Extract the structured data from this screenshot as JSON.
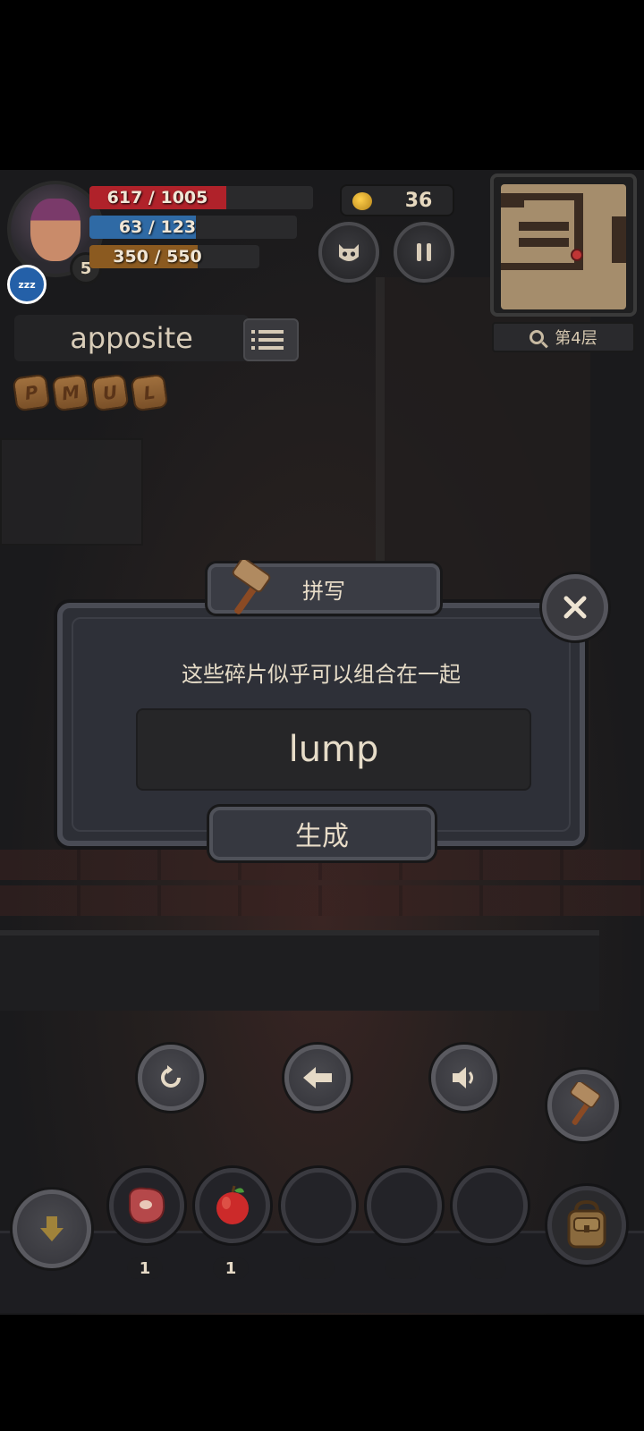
{
  "hud": {
    "hp": {
      "text": "617 / 1005",
      "current": 617,
      "max": 1005,
      "color": "#b0222a"
    },
    "mp": {
      "text": "63 / 123",
      "current": 63,
      "max": 123,
      "color": "#2f6aa5"
    },
    "xp": {
      "text": "350 / 550",
      "current": 350,
      "max": 550,
      "color": "#8b5a20"
    },
    "level": "5",
    "status_badge": "zzz",
    "gold": "36"
  },
  "minimap": {
    "floor_label": "第4层"
  },
  "word_panel": {
    "word": "apposite"
  },
  "fragments": [
    "P",
    "M",
    "U",
    "L"
  ],
  "dialog": {
    "title": "拼写",
    "message": "这些碎片似乎可以组合在一起",
    "input_value": "lump",
    "generate_label": "生成"
  },
  "inventory": {
    "slots": [
      {
        "item": "meat-icon",
        "count": "1"
      },
      {
        "item": "apple-icon",
        "count": "1"
      },
      {
        "item": "",
        "count": ""
      },
      {
        "item": "",
        "count": ""
      },
      {
        "item": "",
        "count": ""
      }
    ]
  }
}
